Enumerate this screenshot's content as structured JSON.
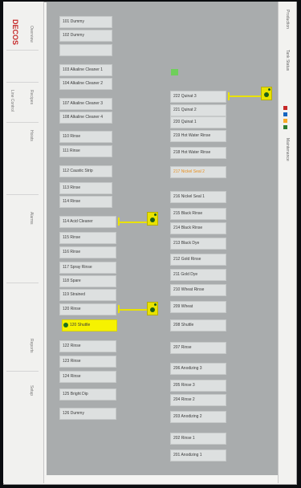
{
  "app": {
    "brand": "DECOS"
  },
  "left_tabs": [
    "Overview",
    "Line Control",
    "Recipes",
    "Hoists",
    "Alarms",
    "Reports",
    "Setup"
  ],
  "right_tabs": [
    "Production",
    "Tank Status",
    "Maintenance"
  ],
  "status_colors": {
    "accent": "#c62828",
    "ok": "#2e7d32",
    "warn": "#f9a825",
    "info": "#1565c0"
  },
  "left_column": [
    {
      "label": "101 Dummy"
    },
    {
      "label": "102 Dummy"
    },
    {
      "label": ""
    },
    {
      "label": "103 Alkaline Cleaner 1"
    },
    {
      "label": "104 Alkaline Cleaner 2"
    },
    {
      "label": "107 Alkaline Cleaner 3"
    },
    {
      "label": "108 Alkaline Cleaner 4"
    },
    {
      "label": "110 Rinse"
    },
    {
      "label": "111 Rinse"
    },
    {
      "label": "112 Caustic Strip"
    },
    {
      "label": "113 Rinse"
    },
    {
      "label": "114 Rinse"
    },
    {
      "label": "114 Acid Cleaner"
    },
    {
      "label": "115 Rinse"
    },
    {
      "label": "116 Rinse"
    },
    {
      "label": "117 Spray Rinse"
    },
    {
      "label": "118 Spare"
    },
    {
      "label": "119 Strained"
    },
    {
      "label": "120 Rinse"
    },
    {
      "label": "120 Shuttle"
    },
    {
      "label": "122 Rinse"
    },
    {
      "label": "123 Rinse"
    },
    {
      "label": "124 Rinse"
    },
    {
      "label": "125 Bright Dip"
    },
    {
      "label": "126 Dummy"
    }
  ],
  "right_column": [
    {
      "label": ""
    },
    {
      "label": "222 Quinat 3"
    },
    {
      "label": "221 Quinat 2"
    },
    {
      "label": "220 Quinat 1"
    },
    {
      "label": "219 Hot Water Rinse"
    },
    {
      "label": "218 Hot Water Rinse"
    },
    {
      "label": "217 Nickel Seal 2"
    },
    {
      "label": "216 Nickel Seal 1"
    },
    {
      "label": "215 Black Rinse"
    },
    {
      "label": "214 Black Rinse"
    },
    {
      "label": "213 Black Dye"
    },
    {
      "label": "212 Gold Rinse"
    },
    {
      "label": "211 Gold Dye"
    },
    {
      "label": "210 Wheat Rinse"
    },
    {
      "label": "209 Wheat"
    },
    {
      "label": "208 Shuttle"
    },
    {
      "label": "207 Rinse"
    },
    {
      "label": "206 Anodizing 3"
    },
    {
      "label": "205 Rinse 3"
    },
    {
      "label": "204 Rinse 2"
    },
    {
      "label": "203 Anodizing 2"
    },
    {
      "label": "202 Rinse 1"
    },
    {
      "label": "201 Anodizing 1"
    }
  ]
}
